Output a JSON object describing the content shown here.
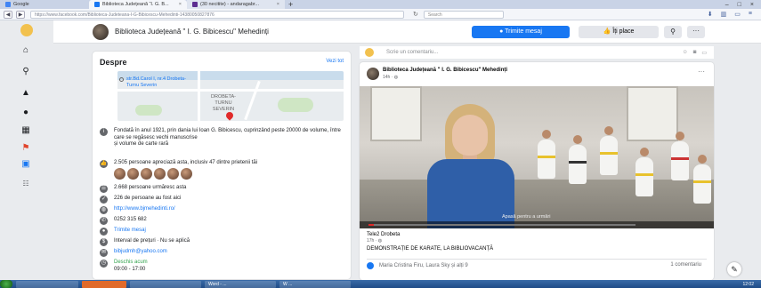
{
  "browser": {
    "tabs": [
      {
        "label": "Google"
      },
      {
        "label": "Biblioteca Județeană “I. G. B..."
      },
      {
        "label": "(30 necitite) - andaragabr..."
      }
    ],
    "new_tab": "+",
    "url": "https://www.facebook.com/Biblioteca-Judeteana-I-G-Bibicescu-Mehedinti-14380050827876",
    "search_placeholder": "Search"
  },
  "page": {
    "name": "Biblioteca Județeană \" I. G. Bibicescu\" Mehedinți",
    "send_message": "Trimite mesaj",
    "like": "Îți place"
  },
  "about": {
    "title": "Despre",
    "see_all": "Vezi tot",
    "map_address": "str.Bd.Carol I, nr.4 Drobeta-\nTurnu Severin",
    "map_city": "DROBETA-\nTURNU\nSEVERIN",
    "description": "Fondată în anul 1921, prin dania lui Ioan G. Bibicescu, cuprinzând peste 20000 de volume, între care se regăsesc vechi manuscrise\nși volume de carte rară",
    "likes": "2.505 persoane apreciază asta, inclusiv 47 dintre prietenii tăi",
    "follows": "2.668 persoane urmăresc asta",
    "checkins": "226 de persoane au fost aici",
    "website": "http://www.bjmehedinti.ro/",
    "phone": "0252 315 682",
    "send_message": "Trimite mesaj",
    "price": "Interval de prețuri · Nu se aplică",
    "email": "bibjudmh@yahoo.com",
    "open_now": "Deschis acum",
    "hours": "09:00 - 17:00"
  },
  "composer": {
    "placeholder": "Scrie un comentariu..."
  },
  "post": {
    "author": "Biblioteca Județeană \" I. G. Bibicescu\" Mehedinți",
    "time": "14h",
    "video_caption": "Apasă pentru a urmări",
    "progress": 0.02,
    "source": "Tele2 Drobeta",
    "source_time": "17h",
    "title": "DEMONSTRAȚIE DE KARATE, LA BIBLIOVACANȚĂ",
    "reactions": "Maria Cristina Firu, Laura Sky și alți 9",
    "comments": "1 comentariu"
  },
  "taskbar": {
    "tasks": [
      "",
      "",
      "",
      "Word - ...",
      "W ..."
    ],
    "clock": "12:02"
  },
  "colors": {
    "brand": "#1877f2",
    "fb_bg": "#e9ebee",
    "open_green": "#31a24c"
  }
}
